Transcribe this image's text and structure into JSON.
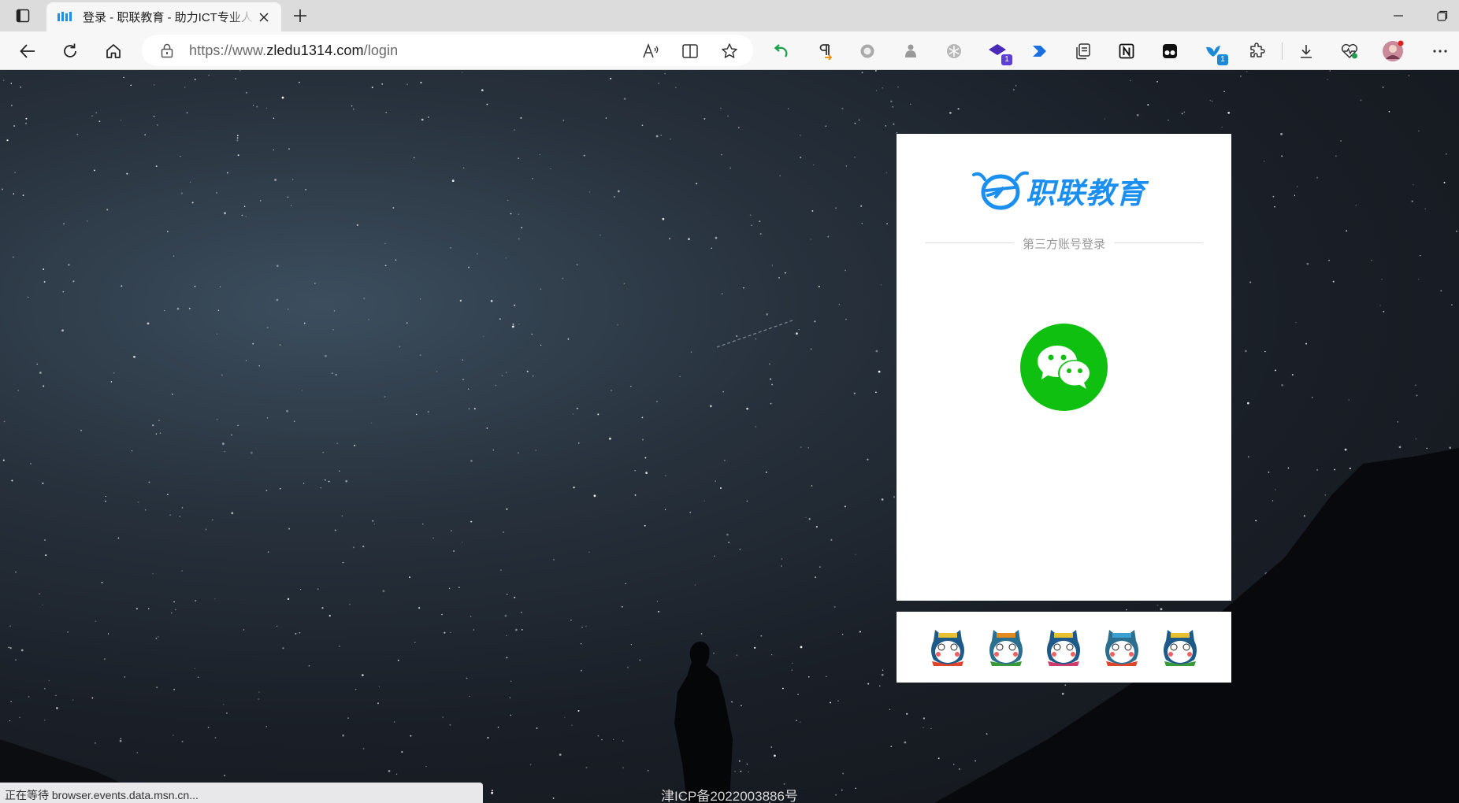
{
  "browser": {
    "tab": {
      "title": "登录 - 职联教育 - 助力ICT专业人才"
    },
    "address": {
      "url_prefix": "https://www.",
      "url_domain": "zledu1314.com",
      "url_path": "/login"
    },
    "extensions": [
      {
        "icon": "back-arrow-ext-icon",
        "badge": ""
      },
      {
        "icon": "pilcrow-ext-icon",
        "badge": ""
      },
      {
        "icon": "circle-ext-icon",
        "badge": ""
      },
      {
        "icon": "puzzle-gray-ext-icon",
        "badge": ""
      },
      {
        "icon": "snowflake-ext-icon",
        "badge": ""
      },
      {
        "icon": "grad-cap-ext-icon",
        "badge": "1"
      },
      {
        "icon": "power-automate-ext-icon",
        "badge": ""
      },
      {
        "icon": "collections-icon",
        "badge": ""
      },
      {
        "icon": "notion-ext-icon",
        "badge": ""
      },
      {
        "icon": "tampermonkey-ext-icon",
        "badge": ""
      },
      {
        "icon": "bird-ext-icon",
        "badge": "1"
      },
      {
        "icon": "extensions-icon",
        "badge": ""
      }
    ]
  },
  "login": {
    "brand_name": "职联教育",
    "third_party_label": "第三方账号登录"
  },
  "footer": {
    "icp": "津ICP备2022003886号"
  },
  "status_bar": "正在等待 browser.events.data.msn.cn...",
  "colors": {
    "brand_blue": "#1a8ff0",
    "wechat_green": "#10c010"
  }
}
